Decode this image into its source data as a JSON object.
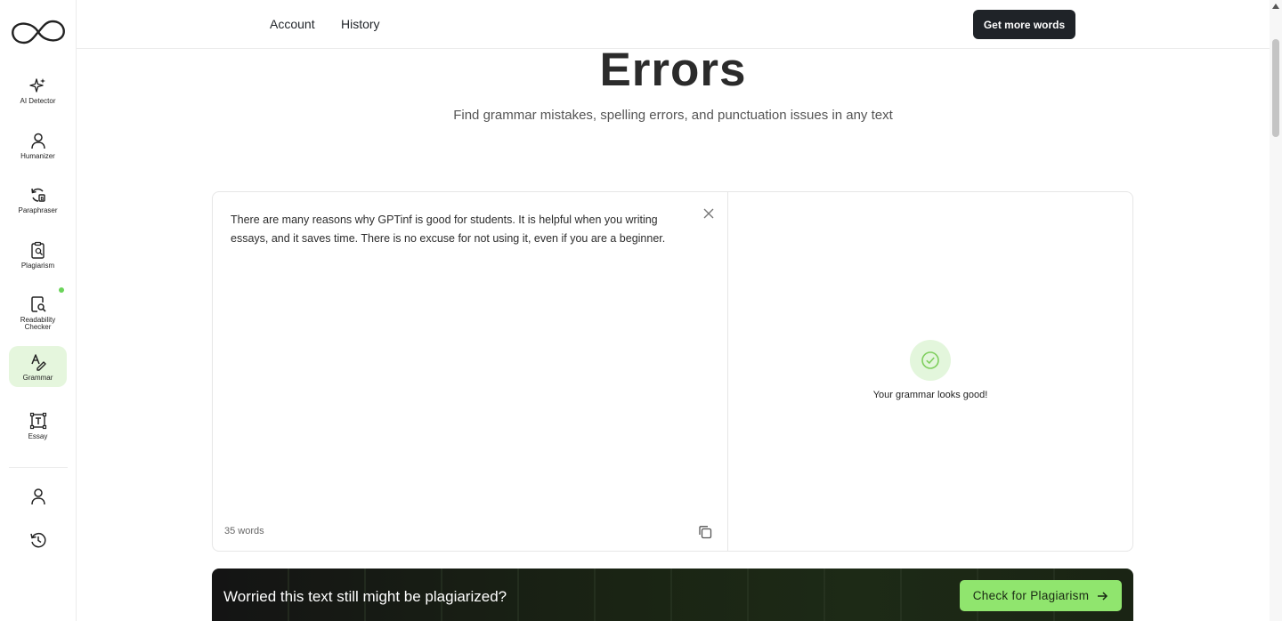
{
  "sidebar": {
    "items": [
      {
        "label": "AI Detector",
        "icon": "sparkle-icon"
      },
      {
        "label": "Humanizer",
        "icon": "person-icon"
      },
      {
        "label": "Paraphraser",
        "icon": "refresh-icon"
      },
      {
        "label": "Plagiarism",
        "icon": "clipboard-search-icon"
      },
      {
        "label": "Readability\nChecker",
        "icon": "document-search-icon"
      },
      {
        "label": "Grammar",
        "icon": "grammar-icon"
      },
      {
        "label": "Essay",
        "icon": "text-frame-icon"
      }
    ],
    "active": "Grammar"
  },
  "topbar": {
    "account": "Account",
    "history": "History",
    "get_more": "Get more words"
  },
  "main": {
    "title": "Errors",
    "subtitle": "Find grammar mistakes, spelling errors, and punctuation issues in any text",
    "input_text": "There are many reasons why GPTinf is good for students. It is helpful when you writing essays, and it saves time. There is no excuse for not using it, even if you are a beginner.",
    "word_count": "35 words",
    "result_message": "Your grammar looks good!"
  },
  "banner": {
    "text": "Worried this text still might be plagiarized?",
    "button": "Check for Plagiarism"
  },
  "colors": {
    "accent_green": "#90e56e",
    "active_bg": "#e5f6dd",
    "dark": "#1f2328"
  }
}
